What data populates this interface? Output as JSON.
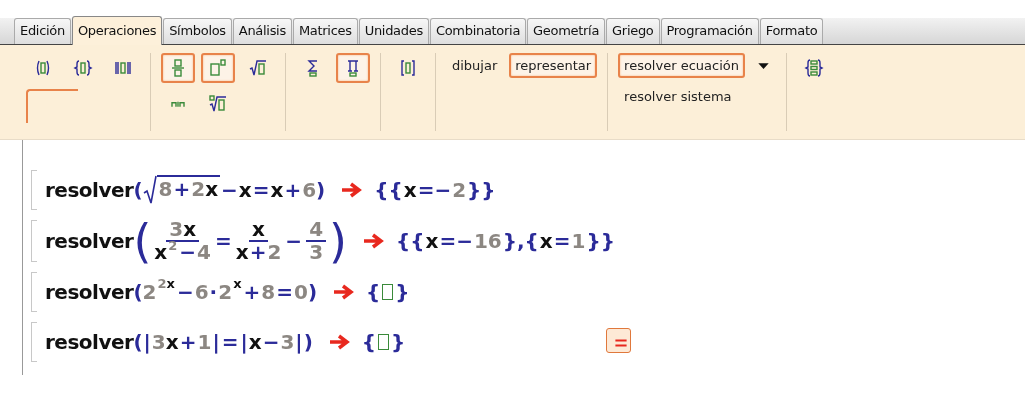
{
  "tabs": [
    {
      "label": "Edición",
      "selected": false
    },
    {
      "label": "Operaciones",
      "selected": true
    },
    {
      "label": "Símbolos",
      "selected": false
    },
    {
      "label": "Análisis",
      "selected": false
    },
    {
      "label": "Matrices",
      "selected": false
    },
    {
      "label": "Unidades",
      "selected": false
    },
    {
      "label": "Combinatoria",
      "selected": false
    },
    {
      "label": "Geometría",
      "selected": false
    },
    {
      "label": "Griego",
      "selected": false
    },
    {
      "label": "Programación",
      "selected": false
    },
    {
      "label": "Formato",
      "selected": false
    }
  ],
  "toolbar": {
    "groups": [
      {
        "rows": [
          [
            {
              "kind": "icon",
              "highlighted": false
            },
            {
              "kind": "icon",
              "highlighted": false
            },
            {
              "kind": "icon",
              "highlighted": false
            }
          ],
          [
            {
              "kind": "blank",
              "highlighted": true
            }
          ]
        ]
      },
      {
        "rows": [
          [
            {
              "kind": "icon",
              "highlighted": true
            },
            {
              "kind": "icon",
              "highlighted": true
            },
            {
              "kind": "icon",
              "highlighted": false
            }
          ],
          [
            {
              "kind": "icon",
              "highlighted": false
            },
            {
              "kind": "icon",
              "highlighted": false
            }
          ]
        ]
      },
      {
        "rows": [
          [
            {
              "kind": "icon",
              "highlighted": false
            },
            {
              "kind": "icon",
              "highlighted": true
            }
          ]
        ]
      },
      {
        "rows": [
          [
            {
              "kind": "icon",
              "highlighted": false
            }
          ]
        ]
      },
      {
        "rows": [
          [
            {
              "kind": "text",
              "label": "dibujar",
              "highlighted": false
            },
            {
              "kind": "text",
              "label": "representar",
              "highlighted": true
            }
          ]
        ]
      },
      {
        "rows": [
          [
            {
              "kind": "text",
              "label": "resolver ecuación",
              "highlighted": true
            },
            {
              "kind": "dropdown",
              "highlighted": false
            }
          ],
          [
            {
              "kind": "text",
              "label": "resolver sistema",
              "highlighted": false
            }
          ]
        ]
      },
      {
        "rows": [
          [
            {
              "kind": "icon",
              "highlighted": false
            }
          ]
        ]
      }
    ]
  },
  "worksheet": {
    "lines": [
      {
        "command": "resolver",
        "open": "(",
        "close": ")",
        "menu_button": false,
        "input": [
          {
            "kind": "sqrt",
            "children": [
              {
                "kind": "number",
                "text": "8"
              },
              {
                "kind": "operator",
                "text": "+"
              },
              {
                "kind": "number",
                "text": "2"
              },
              {
                "kind": "variable",
                "text": "x"
              }
            ]
          },
          {
            "kind": "operator",
            "text": "−"
          },
          {
            "kind": "variable",
            "text": "x"
          },
          {
            "kind": "operator",
            "text": "="
          },
          {
            "kind": "variable",
            "text": "x"
          },
          {
            "kind": "operator",
            "text": "+"
          },
          {
            "kind": "number",
            "text": "6"
          }
        ],
        "result": [
          {
            "kind": "operator",
            "text": "{{"
          },
          {
            "kind": "variable",
            "text": "x"
          },
          {
            "kind": "operator",
            "text": "=−"
          },
          {
            "kind": "number",
            "text": "2"
          },
          {
            "kind": "operator",
            "text": "}}"
          }
        ]
      },
      {
        "command": "resolver",
        "open": "(",
        "close": ")",
        "menu_button": false,
        "input": [
          {
            "kind": "fraction",
            "numerator": [
              {
                "kind": "number",
                "text": "3"
              },
              {
                "kind": "variable",
                "text": "x"
              }
            ],
            "denominator": [
              {
                "kind": "variable",
                "text": "x"
              },
              {
                "kind": "superscript",
                "children": [
                  {
                    "kind": "number",
                    "text": "2"
                  }
                ]
              },
              {
                "kind": "operator",
                "text": "−"
              },
              {
                "kind": "number",
                "text": "4"
              }
            ]
          },
          {
            "kind": "operator",
            "text": "="
          },
          {
            "kind": "fraction",
            "numerator": [
              {
                "kind": "variable",
                "text": "x"
              }
            ],
            "denominator": [
              {
                "kind": "variable",
                "text": "x"
              },
              {
                "kind": "operator",
                "text": "+"
              },
              {
                "kind": "number",
                "text": "2"
              }
            ]
          },
          {
            "kind": "operator",
            "text": "−"
          },
          {
            "kind": "fraction",
            "numerator": [
              {
                "kind": "number",
                "text": "4"
              }
            ],
            "denominator": [
              {
                "kind": "number",
                "text": "3"
              }
            ]
          }
        ],
        "result": [
          {
            "kind": "operator",
            "text": "{{"
          },
          {
            "kind": "variable",
            "text": "x"
          },
          {
            "kind": "operator",
            "text": "=−"
          },
          {
            "kind": "number",
            "text": "16"
          },
          {
            "kind": "operator",
            "text": "},{"
          },
          {
            "kind": "variable",
            "text": "x"
          },
          {
            "kind": "operator",
            "text": "="
          },
          {
            "kind": "number",
            "text": "1"
          },
          {
            "kind": "operator",
            "text": "}}"
          }
        ]
      },
      {
        "command": "resolver",
        "open": "(",
        "close": ")",
        "menu_button": false,
        "input": [
          {
            "kind": "number",
            "text": "2"
          },
          {
            "kind": "superscript",
            "children": [
              {
                "kind": "number",
                "text": "2"
              },
              {
                "kind": "variable",
                "text": "x"
              }
            ]
          },
          {
            "kind": "operator",
            "text": "−"
          },
          {
            "kind": "number",
            "text": "6"
          },
          {
            "kind": "operator",
            "text": "·"
          },
          {
            "kind": "number",
            "text": "2"
          },
          {
            "kind": "superscript",
            "children": [
              {
                "kind": "variable",
                "text": "x"
              }
            ]
          },
          {
            "kind": "operator",
            "text": "+"
          },
          {
            "kind": "number",
            "text": "8"
          },
          {
            "kind": "operator",
            "text": "="
          },
          {
            "kind": "number",
            "text": "0"
          }
        ],
        "result": [
          {
            "kind": "operator",
            "text": "{"
          },
          {
            "kind": "slot"
          },
          {
            "kind": "operator",
            "text": "}"
          }
        ]
      },
      {
        "command": "resolver",
        "open": "(",
        "close": ")",
        "menu_button": true,
        "input": [
          {
            "kind": "operator",
            "text": "|"
          },
          {
            "kind": "number",
            "text": "3"
          },
          {
            "kind": "variable",
            "text": "x"
          },
          {
            "kind": "operator",
            "text": "+"
          },
          {
            "kind": "number",
            "text": "1"
          },
          {
            "kind": "operator",
            "text": "|"
          },
          {
            "kind": "operator",
            "text": "="
          },
          {
            "kind": "operator",
            "text": "|"
          },
          {
            "kind": "variable",
            "text": "x"
          },
          {
            "kind": "operator",
            "text": "−"
          },
          {
            "kind": "number",
            "text": "3"
          },
          {
            "kind": "operator",
            "text": "|"
          }
        ],
        "result": [
          {
            "kind": "operator",
            "text": "{"
          },
          {
            "kind": "slot"
          },
          {
            "kind": "operator",
            "text": "}"
          }
        ]
      }
    ]
  }
}
